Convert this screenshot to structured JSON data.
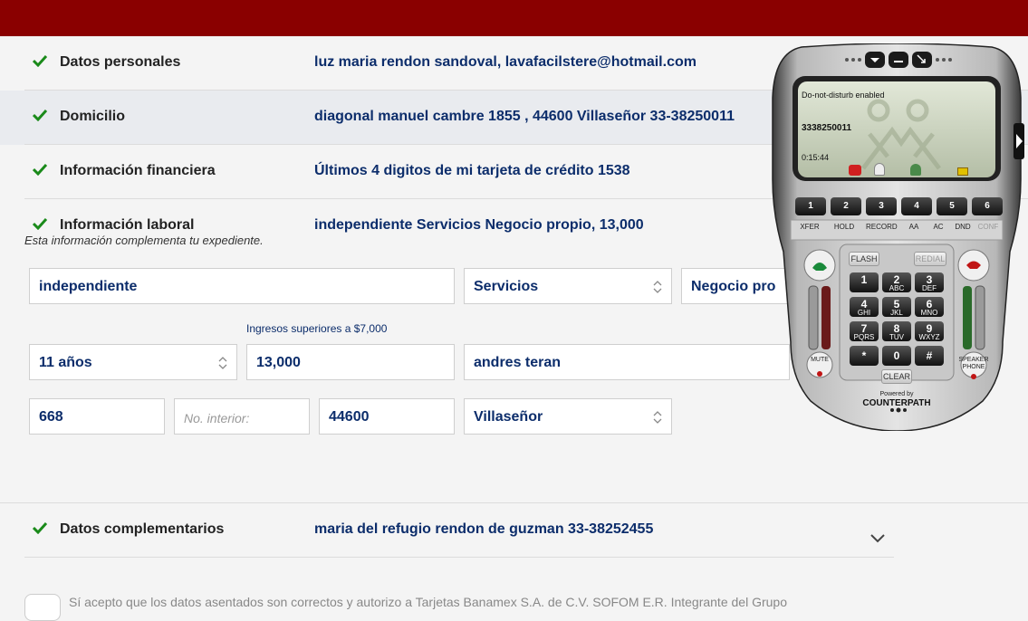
{
  "rows": [
    {
      "label": "Datos personales",
      "value": "luz maria rendon sandoval, lavafacilstere@hotmail.com"
    },
    {
      "label": "Domicilio",
      "value": "diagonal manuel cambre 1855 , 44600 Villaseñor 33-38250011"
    },
    {
      "label": "Información financiera",
      "value": "Últimos 4 digitos de mi tarjeta de crédito 1538"
    },
    {
      "label": "Información laboral",
      "value": "independiente Servicios Negocio propio, 13,000"
    },
    {
      "label": "Datos complementarios",
      "value": "maria del refugio rendon de guzman 33-38252455"
    }
  ],
  "labor_note": "Esta información complementa tu expediente.",
  "form": {
    "occupation": "independiente",
    "sector": "Servicios",
    "business_type": "Negocio pro",
    "income_label": "Ingresos superiores a $7,000",
    "seniority": "11 años",
    "income": "13,000",
    "company": "andres teran",
    "ext_number": "668",
    "int_number_placeholder": "No. interior:",
    "zip": "44600",
    "colony": "Villaseñor"
  },
  "consent": "Sí acepto que los datos asentados son correctos y autorizo a Tarjetas Banamex S.A. de C.V. SOFOM E.R. Integrante del Grupo",
  "softphone": {
    "status": "Do-not-disturb enabled",
    "number": "3338250011",
    "timer": "0:15:44",
    "lines": [
      "1",
      "2",
      "3",
      "4",
      "5",
      "6"
    ],
    "functions": [
      "XFER",
      "HOLD",
      "RECORD",
      "AA",
      "AC",
      "DND",
      "CONF"
    ],
    "flash": "FLASH",
    "redial": "REDIAL",
    "keys": [
      {
        "n": "1",
        "l": ""
      },
      {
        "n": "2",
        "l": "ABC"
      },
      {
        "n": "3",
        "l": "DEF"
      },
      {
        "n": "4",
        "l": "GHI"
      },
      {
        "n": "5",
        "l": "JKL"
      },
      {
        "n": "6",
        "l": "MNO"
      },
      {
        "n": "7",
        "l": "PQRS"
      },
      {
        "n": "8",
        "l": "TUV"
      },
      {
        "n": "9",
        "l": "WXYZ"
      },
      {
        "n": "*",
        "l": ""
      },
      {
        "n": "0",
        "l": ""
      },
      {
        "n": "#",
        "l": ""
      }
    ],
    "clear": "CLEAR",
    "mute": "MUTE",
    "speaker": "SPEAKER PHONE",
    "powered_by": "Powered by",
    "brand": "COUNTERPATH"
  },
  "colors": {
    "topbar": "#8a0000",
    "check": "#1a8a1a",
    "value_text": "#0c2d6b"
  }
}
